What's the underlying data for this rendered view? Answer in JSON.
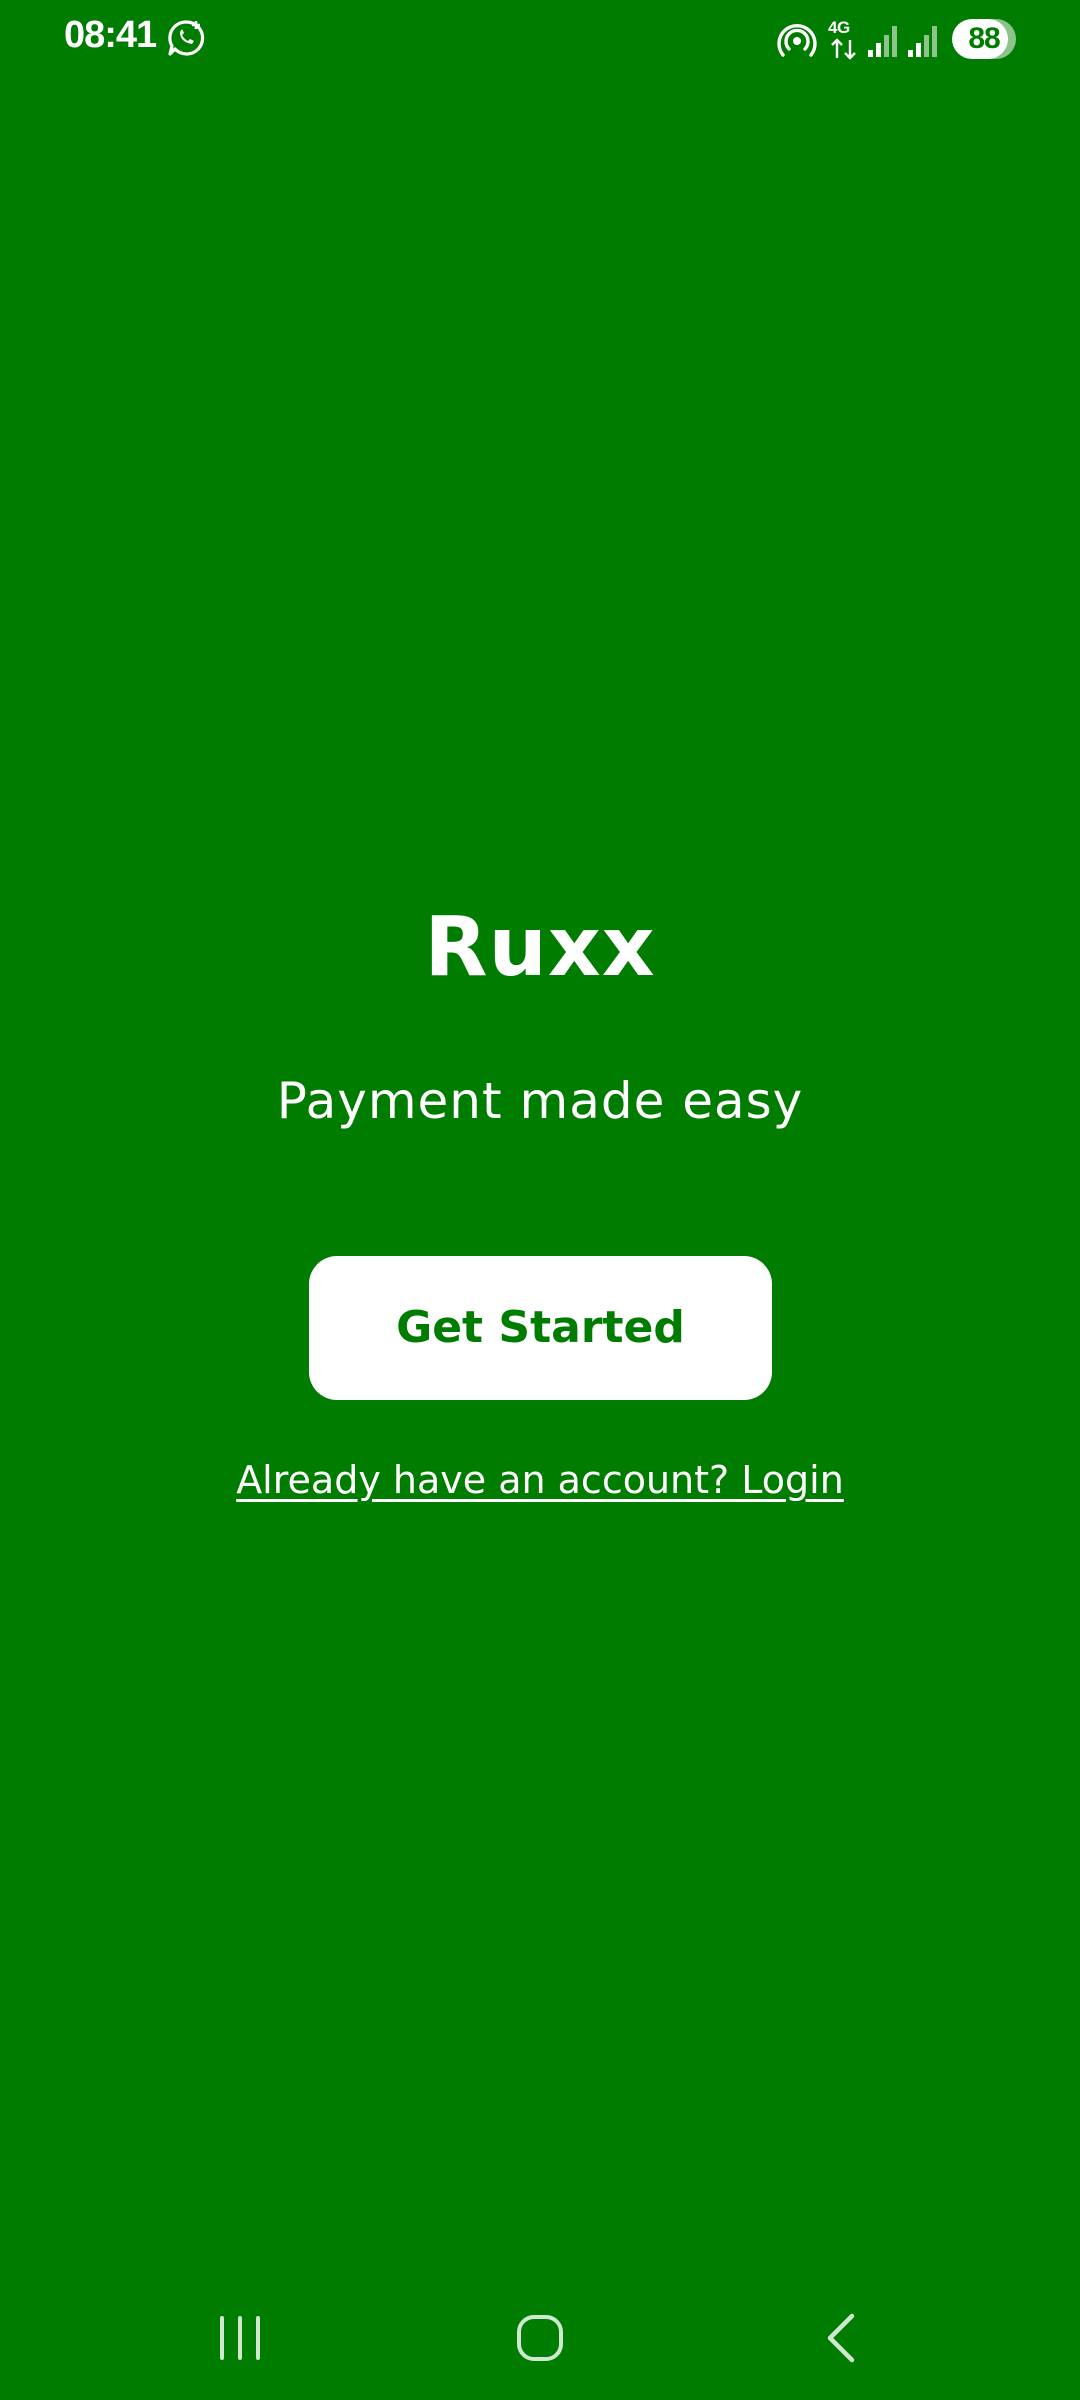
{
  "status_bar": {
    "time": "08:41",
    "network_type": "4G",
    "battery_level": "88",
    "battery_fraction": 0.88,
    "icons": [
      "whatsapp-icon",
      "hotspot-icon",
      "network-4g-icon",
      "signal-icon",
      "signal-icon",
      "battery-icon"
    ]
  },
  "app": {
    "title": "Ruxx",
    "tagline": "Payment made easy",
    "get_started_label": "Get Started",
    "login_prompt": "Already have an account? Login"
  },
  "colors": {
    "background": "#007c00",
    "accent": "#ffffff"
  },
  "nav_bar": {
    "icons": [
      "recents-icon",
      "home-icon",
      "back-icon"
    ]
  }
}
